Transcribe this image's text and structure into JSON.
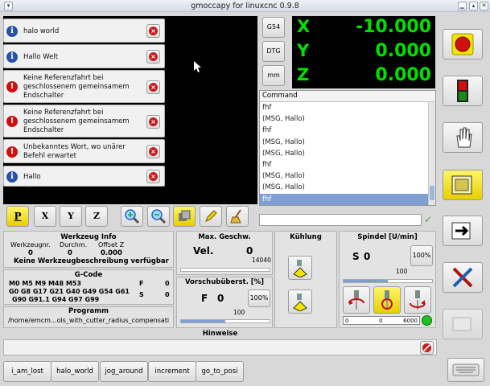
{
  "window": {
    "title": "gmoccapy for linuxcnc 0.9.8"
  },
  "messages": [
    {
      "type": "info",
      "text": "halo world"
    },
    {
      "type": "info",
      "text": "Hallo Welt"
    },
    {
      "type": "error",
      "text": "Keine Referenzfahrt bei geschlossenem gemeinsamem Endschalter"
    },
    {
      "type": "error",
      "text": "Keine Referenzfahrt bei geschlossenem gemeinsamem Endschalter"
    },
    {
      "type": "error",
      "text": "Unbekanntes Wort, wo unärer Befehl erwartet"
    },
    {
      "type": "info",
      "text": "Hallo"
    }
  ],
  "side_buttons": {
    "g54": "G54",
    "dtg": "DTG",
    "mm": "mm"
  },
  "dro": {
    "x_label": "X",
    "x": "-10.000",
    "y_label": "Y",
    "y": "0.000",
    "z_label": "Z",
    "z": "0.000"
  },
  "command": {
    "header": "Command",
    "rows": [
      "fhf",
      "(MSG, Hallo)",
      "fhf",
      "(MSG, Hallo)",
      "(MSG, Hallo)",
      "fhf",
      "(MSG, Hallo)",
      "(MSG, Hallo)",
      "fhf"
    ],
    "selected_index": 8,
    "input_value": ""
  },
  "view_buttons": {
    "p": "P",
    "x": "X",
    "y": "Y",
    "z": "Z"
  },
  "tool": {
    "title": "Werkzeug Info",
    "nr_label": "Werkzeugnr.",
    "diam_label": "Durchm.",
    "offset_label": "Offset Z",
    "nr": "0",
    "diam": "0",
    "offset": "0.000",
    "desc": "Keine Werkzeugbeschreibung verfügbar"
  },
  "gcode": {
    "title": "G-Code",
    "line1": "M0 M5 M9 M48 M53",
    "line2": "G0 G8 G17 G21 G40 G49 G54 G61",
    "line3": "G90 G91.1 G94 G97 G99",
    "f_label": "F",
    "f": "0",
    "s_label": "S",
    "s": "0"
  },
  "program": {
    "title": "Programm",
    "path": "/home/emcm...ols_with_cutter_radius_compensati"
  },
  "maxvel": {
    "title": "Max. Geschw.",
    "label": "Vel.",
    "value": "0",
    "max": "14040",
    "fraction": 0.0
  },
  "feed": {
    "title": "Vorschubüberst. [%]",
    "label": "F",
    "value": "0",
    "pct_button": "100%",
    "scale": "100",
    "fraction": 0.5
  },
  "cooling": {
    "title": "Kühlung"
  },
  "spindle": {
    "title": "Spindel [U/min]",
    "label": "S",
    "value": "0",
    "pct_button": "100%",
    "scale": "100",
    "fraction": 0.5,
    "bar_min": "0",
    "bar_val": "0",
    "bar_max": "6000"
  },
  "hints": {
    "title": "Hinweise"
  },
  "macros": [
    "i_am_lost",
    "halo_world",
    "jog_around",
    "increment",
    "go_to_posi"
  ],
  "colors": {
    "dro_green": "#00e000",
    "selection": "#7f9fd4",
    "estop_red": "#d01010",
    "yellow": "#f2e600"
  }
}
